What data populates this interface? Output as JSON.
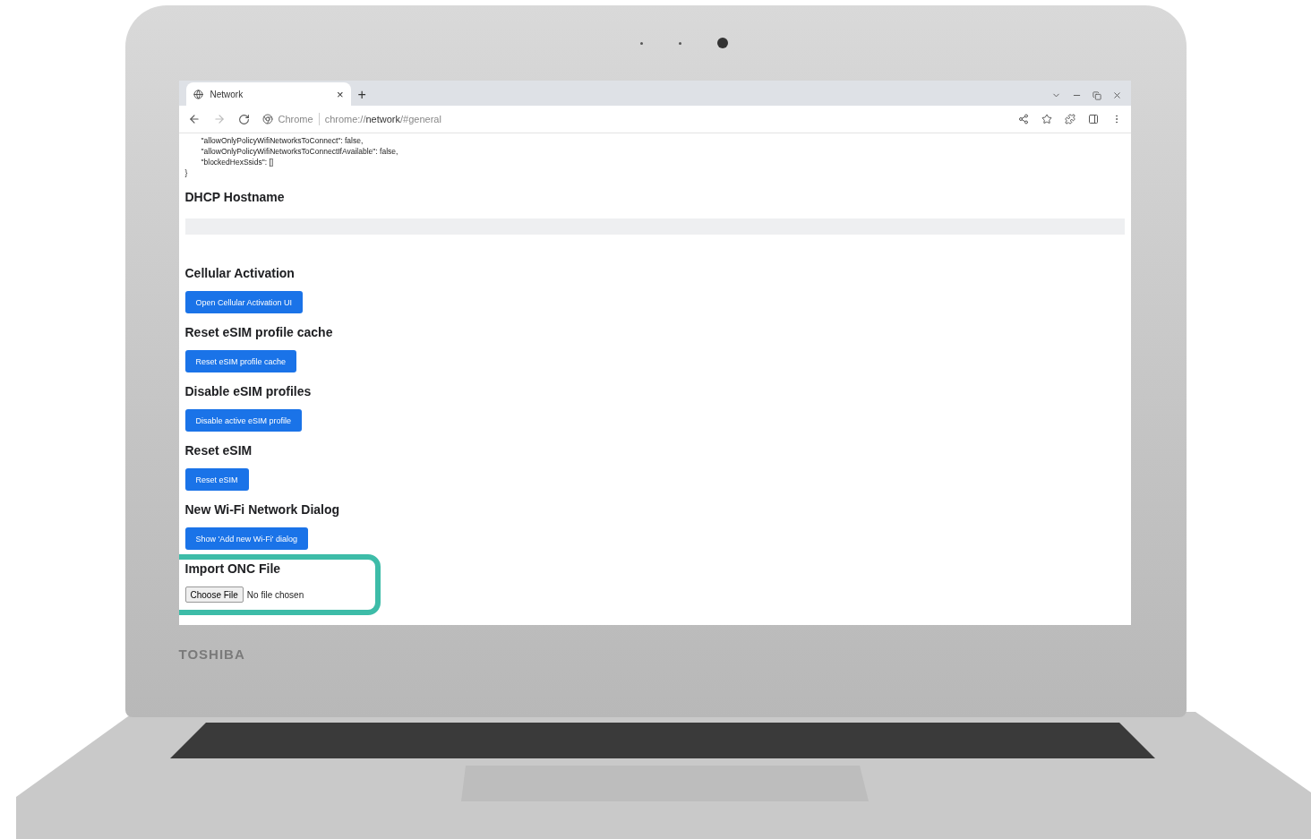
{
  "browser": {
    "tab_title": "Network",
    "tab_close": "×",
    "new_tab": "+",
    "site_label": "Chrome",
    "url": "chrome://**network**/#general"
  },
  "code_lines": [
    {
      "text": "\"allowOnlyPolicyWifiNetworksToConnect\": false,",
      "indented": true
    },
    {
      "text": "\"allowOnlyPolicyWifiNetworksToConnectIfAvailable\": false,",
      "indented": true
    },
    {
      "text": "\"blockedHexSsids\": []",
      "indented": true
    },
    {
      "text": "}",
      "indented": false
    }
  ],
  "sections": [
    {
      "kind": "hostname",
      "heading": "DHCP Hostname",
      "highlighted": false
    },
    {
      "kind": "button",
      "heading": "Cellular Activation",
      "button": "Open Cellular Activation UI",
      "highlighted": false
    },
    {
      "kind": "button",
      "heading": "Reset eSIM profile cache",
      "button": "Reset eSIM profile cache",
      "highlighted": false
    },
    {
      "kind": "button",
      "heading": "Disable eSIM profiles",
      "button": "Disable active eSIM profile",
      "highlighted": false
    },
    {
      "kind": "button",
      "heading": "Reset eSIM",
      "button": "Reset eSIM",
      "highlighted": false
    },
    {
      "kind": "button",
      "heading": "New Wi-Fi Network Dialog",
      "button": "Show 'Add new Wi-Fi' dialog",
      "highlighted": false
    },
    {
      "kind": "file",
      "heading": "Import ONC File",
      "button": "Choose File",
      "status": "No file chosen",
      "highlighted": true
    }
  ],
  "laptop": {
    "brand": "TOSHIBA"
  }
}
